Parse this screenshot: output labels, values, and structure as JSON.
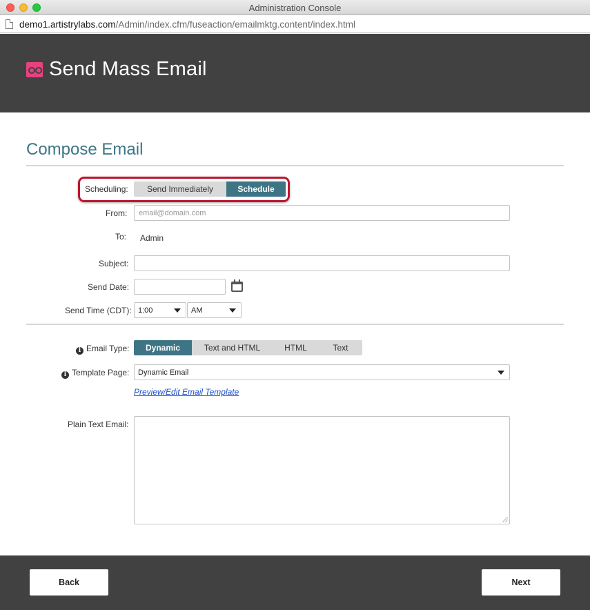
{
  "window": {
    "title": "Administration Console"
  },
  "address_bar": {
    "host": "demo1.artistrylabs.com",
    "path": "/Admin/index.cfm/fuseaction/emailmktg.content/index.html"
  },
  "header": {
    "title": "Send Mass Email"
  },
  "page": {
    "title": "Compose Email"
  },
  "form": {
    "scheduling": {
      "label": "Scheduling:",
      "options": [
        "Send Immediately",
        "Schedule"
      ],
      "selected": "Schedule"
    },
    "from": {
      "label": "From:",
      "placeholder": "email@domain.com",
      "value": ""
    },
    "to": {
      "label": "To:",
      "value": "Admin"
    },
    "subject": {
      "label": "Subject:",
      "value": ""
    },
    "send_date": {
      "label": "Send Date:",
      "value": ""
    },
    "send_time": {
      "label": "Send Time (CDT):",
      "hour": "1:00",
      "meridiem": "AM"
    },
    "email_type": {
      "label": "Email Type:",
      "options": [
        "Dynamic",
        "Text and HTML",
        "HTML",
        "Text"
      ],
      "selected": "Dynamic"
    },
    "template_page": {
      "label": "Template Page:",
      "value": "Dynamic Email"
    },
    "preview_link": "Preview/Edit Email Template",
    "plain_text_email": {
      "label": "Plain Text Email:",
      "value": ""
    }
  },
  "footer": {
    "back_label": "Back",
    "next_label": "Next"
  },
  "colors": {
    "accent": "#3d7585",
    "header_bg": "#414141",
    "logo": "#e8417f",
    "highlight_ring": "#c0152f",
    "link": "#1d4fc9"
  },
  "icons": [
    "logo-icon",
    "page-icon",
    "info-icon",
    "calendar-icon",
    "chevron-down-icon"
  ]
}
